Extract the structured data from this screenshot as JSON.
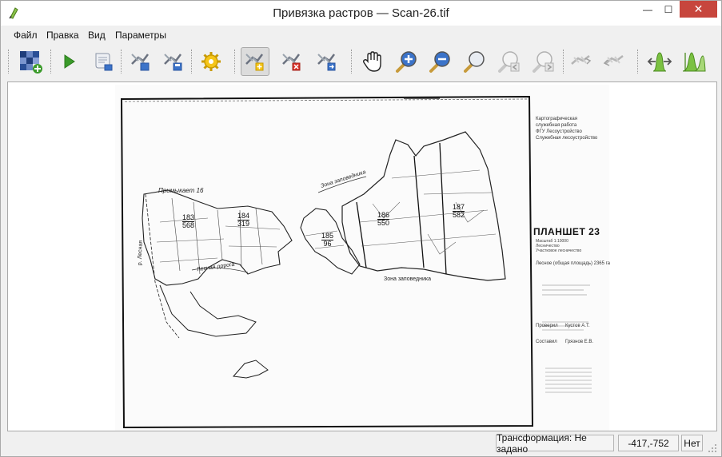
{
  "window": {
    "title": "Привязка растров — Scan-26.tif",
    "minimize_glyph": "—",
    "maximize_glyph": "☐",
    "close_glyph": "✕"
  },
  "menu": {
    "items": [
      "Файл",
      "Правка",
      "Вид",
      "Параметры"
    ]
  },
  "toolbar": {
    "buttons": [
      {
        "name": "open-raster-icon"
      },
      {
        "name": "start-georeferencing-icon"
      },
      {
        "name": "generate-gdal-script-icon"
      },
      {
        "name": "load-gcp-points-icon"
      },
      {
        "name": "save-gcp-points-icon"
      },
      {
        "name": "transformation-settings-icon"
      },
      {
        "name": "add-point-icon",
        "active": true
      },
      {
        "name": "delete-point-icon"
      },
      {
        "name": "move-gcp-point-icon"
      },
      {
        "name": "pan-icon"
      },
      {
        "name": "zoom-in-icon"
      },
      {
        "name": "zoom-out-icon"
      },
      {
        "name": "zoom-to-layer-icon"
      },
      {
        "name": "zoom-last-icon"
      },
      {
        "name": "zoom-next-icon"
      },
      {
        "name": "link-georeferencer-icon"
      },
      {
        "name": "link-qgis-icon"
      },
      {
        "name": "full-histogram-stretch-icon"
      },
      {
        "name": "local-histogram-stretch-icon"
      }
    ]
  },
  "map": {
    "header_right": [
      "Картографическая",
      "служебная работа",
      "ФГУ Лесоустройство",
      "Служебная лесоустройство"
    ],
    "plan_title": "ПЛАНШЕТ 23",
    "plan_sub": [
      "Масштаб 1:10000",
      "Лесничество",
      "Участковое лесничество"
    ],
    "plan_scale": "Лесное (общая площадь) 2365 га",
    "labels": {
      "kvartal_left": "Примыкает 16",
      "zone_top": "Зона заповедника",
      "zone_bottom": "Зона заповедника",
      "road": "Лесная дорога",
      "river": "р. Лесная",
      "num_183": "183",
      "area_183": "568",
      "num_184": "184",
      "area_184": "319",
      "num_185": "185",
      "area_185": "96",
      "num_186": "186",
      "area_186": "550",
      "num_187": "187",
      "area_187": "582",
      "right_note_1": "Проверил",
      "right_note_2": "Кустов А.Т.",
      "right_note_3": "Составил",
      "right_note_4": "Грязнов Е.В."
    }
  },
  "status": {
    "transform": "Трансформация: Не задано",
    "coords": "-417,-752",
    "projection": "Нет"
  },
  "colors": {
    "close_red": "#c7463d",
    "green_accent": "#3a9a2a",
    "zoom_blue": "#3b73c9"
  }
}
